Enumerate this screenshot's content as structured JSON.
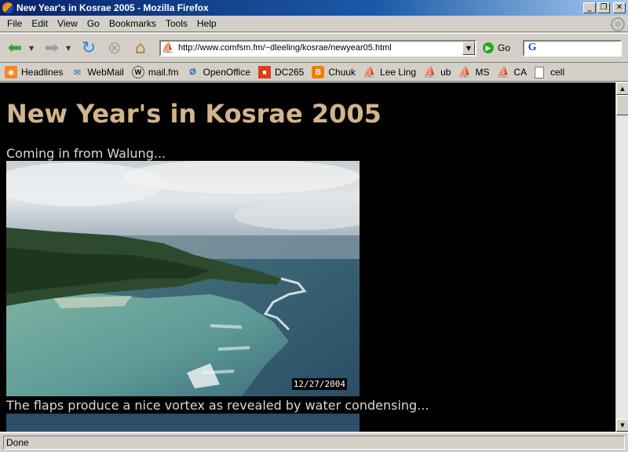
{
  "window": {
    "title": "New Year's in Kosrae 2005 - Mozilla Firefox"
  },
  "menu": [
    "File",
    "Edit",
    "View",
    "Go",
    "Bookmarks",
    "Tools",
    "Help"
  ],
  "nav": {
    "url": "http://www.comfsm.fm/~dleeling/kosrae/newyear05.html",
    "go_label": "Go",
    "search_value": ""
  },
  "bookmarks": [
    "Headlines",
    "WebMail",
    "mail.fm",
    "OpenOffice",
    "DC265",
    "Chuuk",
    "Lee Ling",
    "ub",
    "MS",
    "CA",
    "cell"
  ],
  "page": {
    "title": "New Year's in Kosrae 2005",
    "caption1": "Coming in from Walung...",
    "photo1_date": "12/27/2004",
    "caption2": "The flaps produce a nice vortex as revealed by water condensing..."
  },
  "status": {
    "text": "Done"
  },
  "colors": {
    "page_bg": "#000000",
    "title_color": "#d2b48c",
    "caption_color": "#d8d8d8"
  }
}
